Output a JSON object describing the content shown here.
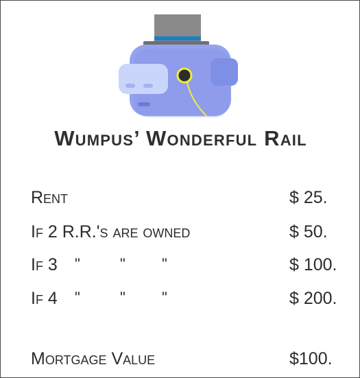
{
  "card": {
    "title": "Wumpus’ Wonderful Rail",
    "rows": [
      {
        "label": "Rent",
        "value": "$ 25."
      },
      {
        "label": "If 2 R.R.'s are owned",
        "value": "$ 50."
      },
      {
        "label": "If 3",
        "dittos": [
          "\"",
          "\"",
          "\""
        ],
        "value": "$ 100."
      },
      {
        "label": "If 4",
        "dittos": [
          "\"",
          "\"",
          "\""
        ],
        "value": "$ 200."
      }
    ],
    "mortgage": {
      "label": "Mortgage Value",
      "value": "$100."
    }
  },
  "mascot": {
    "icon": "wumpus-top-hat-monocle-icon"
  },
  "colors": {
    "hat_gray": "#8a8a8a",
    "hat_band": "#1d7fc1",
    "body": "#95a2ee",
    "face": "#c9d5fb",
    "monocle": "#f2ec3a",
    "border": "#4a4a4a"
  }
}
